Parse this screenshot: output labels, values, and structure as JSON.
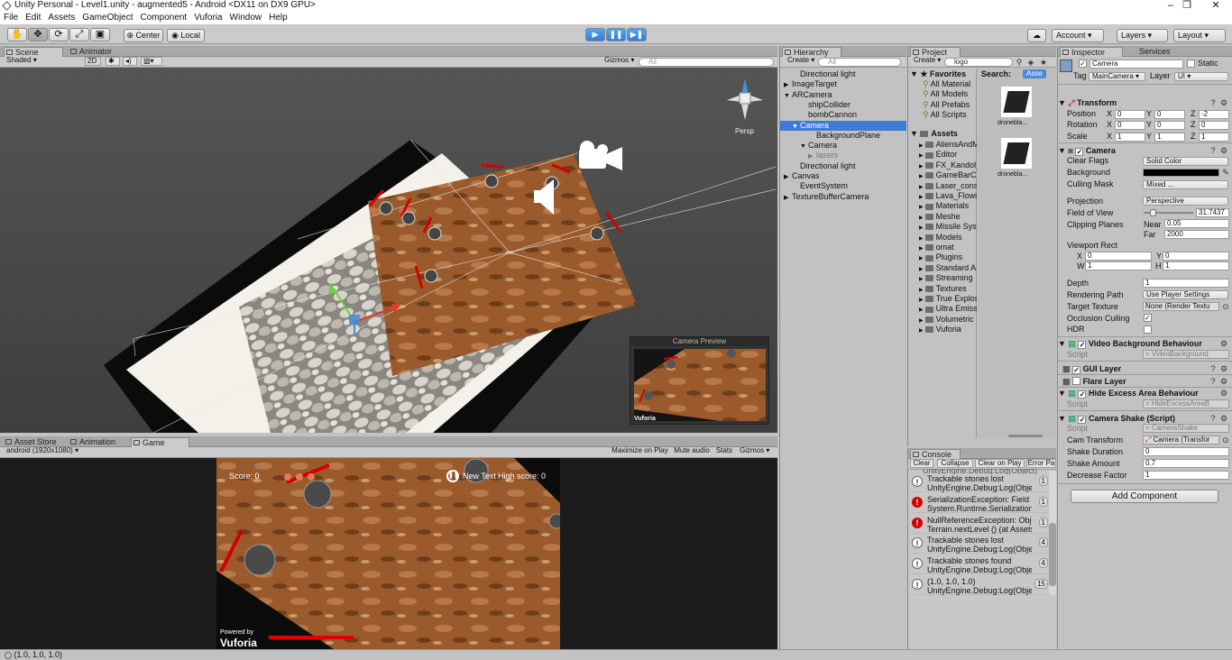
{
  "window": {
    "title": "Unity Personal - Level1.unity - augmented5 - Android <DX11 on DX9 GPU>",
    "minimize": "–",
    "maximize": "❐",
    "close": "✕"
  },
  "menu": [
    "File",
    "Edit",
    "Assets",
    "GameObject",
    "Component",
    "Vuforia",
    "Window",
    "Help"
  ],
  "toolbar": {
    "center": "Center",
    "local": "Local",
    "account": "Account",
    "layers": "Layers",
    "layout": "Layout"
  },
  "scene": {
    "tabs": [
      "Scene",
      "Animator"
    ],
    "shading": "Shaded",
    "mode2d": "2D",
    "gizmos": "Gizmos",
    "search_placeholder": "All",
    "persp": "Persp",
    "preview_title": "Camera Preview",
    "preview_vuforia": "Vuforia"
  },
  "game": {
    "tabs": [
      "Asset Store",
      "Animation",
      "Game"
    ],
    "resolution": "android (1920x1080)",
    "maximize": "Maximize on Play",
    "mute": "Mute audio",
    "stats": "Stats",
    "gizmos": "Gizmos",
    "score": "Score: 0",
    "new_text": "New Text",
    "high_score": "High score: 0",
    "powered_by": "Powered by",
    "vuforia": "Vuforia"
  },
  "hierarchy": {
    "tab": "Hierarchy",
    "create": "Create",
    "search_placeholder": "All",
    "items": [
      {
        "label": "Directional light",
        "indent": 1,
        "arrow": ""
      },
      {
        "label": "ImageTarget",
        "indent": 0,
        "arrow": "▶"
      },
      {
        "label": "ARCamera",
        "indent": 0,
        "arrow": "▼"
      },
      {
        "label": "shipCollider",
        "indent": 2,
        "arrow": ""
      },
      {
        "label": "bombCannon",
        "indent": 2,
        "arrow": ""
      },
      {
        "label": "Camera",
        "indent": 1,
        "arrow": "▼",
        "selected": true
      },
      {
        "label": "BackgroundPlane",
        "indent": 3,
        "arrow": ""
      },
      {
        "label": "Camera",
        "indent": 2,
        "arrow": "▼"
      },
      {
        "label": "lasers",
        "indent": 3,
        "arrow": "▶",
        "dim": true
      },
      {
        "label": "Directional light",
        "indent": 1,
        "arrow": ""
      },
      {
        "label": "Canvas",
        "indent": 0,
        "arrow": "▶"
      },
      {
        "label": "EventSystem",
        "indent": 1,
        "arrow": ""
      },
      {
        "label": "TextureBufferCamera",
        "indent": 0,
        "arrow": "▶"
      }
    ]
  },
  "project": {
    "tab": "Project",
    "create": "Create",
    "search": "logo",
    "search_label": "Search:",
    "search_scope": "Asse",
    "favorites_label": "Favorites",
    "favorites": [
      "All Material",
      "All Models",
      "All Prefabs",
      "All Scripts"
    ],
    "assets_label": "Assets",
    "folders": [
      "AliensAndM",
      "Editor",
      "FX_Kandol_",
      "GameBarC",
      "Laser_cons",
      "Lava_Flowi",
      "Materials",
      "Meshe",
      "Missile Syst",
      "Models",
      "omat",
      "Plugins",
      "Standard A",
      "Streaming",
      "Textures",
      "True Explos",
      "Ultra Emiss",
      "Volumetric",
      "Vuforia"
    ],
    "results": [
      "dronebla...",
      "dronebla..."
    ]
  },
  "console": {
    "tab": "Console",
    "clear": "Clear",
    "collapse": "Collapse",
    "clear_on_play": "Clear on Play",
    "error_pause": "Error Pa",
    "top_partial": "UnityEngine.Debug:Log(Object)",
    "rows": [
      {
        "type": "warn",
        "l1": "Trackable stones lost",
        "l2": "UnityEngine.Debug:Log(Object)",
        "count": "1"
      },
      {
        "type": "err",
        "l1": "SerializationException: Field 'u",
        "l2": "System.Runtime.Serialization.Fo",
        "count": "1"
      },
      {
        "type": "err",
        "l1": "NullReferenceException: Object r",
        "l2": "Terrain.nextLevel () (at Assets/",
        "count": "1"
      },
      {
        "type": "warn",
        "l1": "Trackable stones lost",
        "l2": "UnityEngine.Debug:Log(Object)",
        "count": "4"
      },
      {
        "type": "warn",
        "l1": "Trackable stones found",
        "l2": "UnityEngine.Debug:Log(Object)",
        "count": "4"
      },
      {
        "type": "warn",
        "l1": "(1.0, 1.0, 1.0)",
        "l2": "UnityEngine.Debug:Log(Object)",
        "count": "15"
      }
    ]
  },
  "inspector": {
    "tabs": [
      "Inspector",
      "Services"
    ],
    "object_name": "Camera",
    "static": "Static",
    "tag_label": "Tag",
    "tag": "MainCamera",
    "layer_label": "Layer",
    "layer": "UI",
    "transform": {
      "title": "Transform",
      "position_label": "Position",
      "rotation_label": "Rotation",
      "scale_label": "Scale",
      "position": [
        "0",
        "0",
        "-2"
      ],
      "rotation": [
        "0",
        "0",
        "0"
      ],
      "scale": [
        "1",
        "1",
        "1"
      ]
    },
    "camera": {
      "title": "Camera",
      "clear_flags_label": "Clear Flags",
      "clear_flags": "Solid Color",
      "background_label": "Background",
      "background_color": "#000000",
      "culling_mask_label": "Culling Mask",
      "culling_mask": "Mixed ...",
      "projection_label": "Projection",
      "projection": "Perspective",
      "fov_label": "Field of View",
      "fov": "31.7437",
      "fov_fraction": 0.18,
      "clipping_label": "Clipping Planes",
      "near_label": "Near",
      "near": "0.05",
      "far_label": "Far",
      "far": "2000",
      "viewport_label": "Viewport Rect",
      "vx": "0",
      "vy": "0",
      "vw": "1",
      "vh": "1",
      "depth_label": "Depth",
      "depth": "1",
      "rendering_path_label": "Rendering Path",
      "rendering_path": "Use Player Settings",
      "target_texture_label": "Target Texture",
      "target_texture": "None (Render Textu",
      "occlusion_label": "Occlusion Culling",
      "occlusion": true,
      "hdr_label": "HDR",
      "hdr": false
    },
    "video_bg": {
      "title": "Video Background Behaviour",
      "script_label": "Script",
      "script": "VideoBackground"
    },
    "gui_layer": {
      "title": "GUI Layer"
    },
    "flare_layer": {
      "title": "Flare Layer"
    },
    "hide_excess": {
      "title": "Hide Excess Area Behaviour",
      "script_label": "Script",
      "script": "HideExcessAreaB"
    },
    "camera_shake": {
      "title": "Camera Shake (Script)",
      "script_label": "Script",
      "script": "CameraShake",
      "cam_transform_label": "Cam Transform",
      "cam_transform": "Camera (Transfor",
      "shake_duration_label": "Shake Duration",
      "shake_duration": "0",
      "shake_amount_label": "Shake Amount",
      "shake_amount": "0.7",
      "decrease_factor_label": "Decrease Factor",
      "decrease_factor": "1"
    },
    "add_component": "Add Component"
  },
  "statusbar": {
    "text": "(1.0, 1.0, 1.0)"
  },
  "colors": {
    "selection": "#3d7bd6",
    "accent_play": "#3d8de0",
    "error": "#d40000"
  }
}
